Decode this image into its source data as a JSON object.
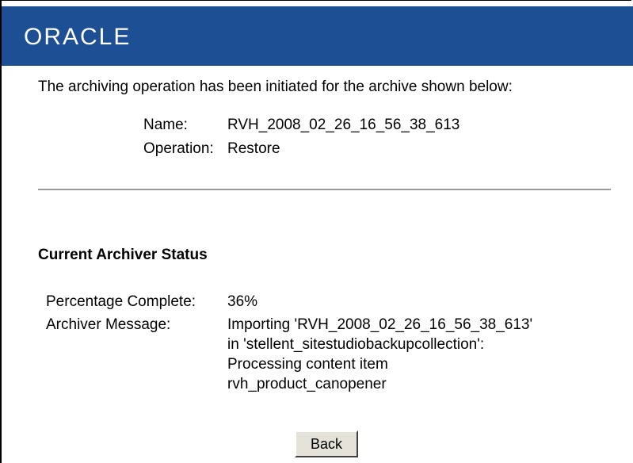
{
  "header": {
    "logo_text": "ORACLE"
  },
  "intro_text": "The archiving operation has been initiated for the archive shown below:",
  "archive": {
    "name_label": "Name:",
    "name_value": "RVH_2008_02_26_16_56_38_613",
    "operation_label": "Operation:",
    "operation_value": "Restore"
  },
  "status": {
    "title": "Current Archiver Status",
    "percentage_label": "Percentage Complete:",
    "percentage_value": "36%",
    "message_label": "Archiver Message:",
    "message_lines": [
      "Importing 'RVH_2008_02_26_16_56_38_613'",
      "in 'stellent_sitestudiobackupcollection':",
      "Processing content item",
      "rvh_product_canopener"
    ]
  },
  "back_button_label": "Back",
  "colors": {
    "header_bg": "#1c4f93",
    "logo": "#ffffff",
    "divider": "#9a9a9a"
  }
}
